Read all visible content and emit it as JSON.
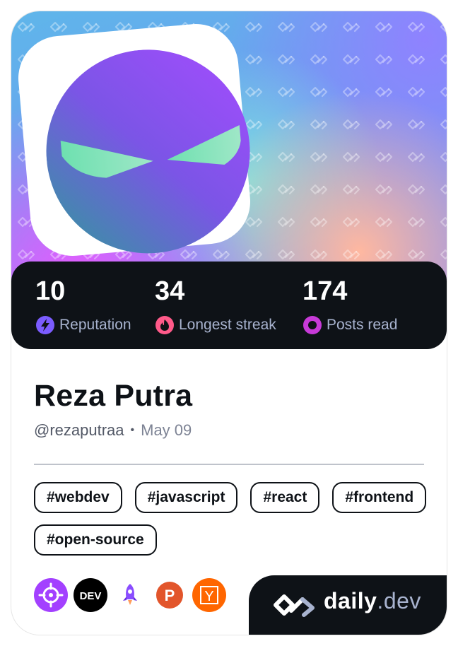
{
  "profile": {
    "name": "Reza Putra",
    "handle": "@rezaputraa",
    "separator": "•",
    "date": "May 09"
  },
  "stats": [
    {
      "value": "10",
      "label": "Reputation",
      "icon": "lightning-icon",
      "color": "#7b5cff"
    },
    {
      "value": "34",
      "label": "Longest streak",
      "icon": "flame-icon",
      "color": "#ff5a8a"
    },
    {
      "value": "174",
      "label": "Posts read",
      "icon": "eye-icon",
      "color": "#c73ad8"
    }
  ],
  "tags": [
    "#webdev",
    "#javascript",
    "#react",
    "#frontend",
    "#open-source"
  ],
  "sources": [
    {
      "icon": "crosshair-source-icon",
      "color": "#a340ff"
    },
    {
      "icon": "dev-to-source-icon",
      "label": "DEV",
      "color": "#000000"
    },
    {
      "icon": "rocket-source-icon",
      "color": "#8a4dff"
    },
    {
      "icon": "product-hunt-source-icon",
      "label": "P",
      "color": "#e2552b"
    },
    {
      "icon": "hacker-news-source-icon",
      "label": "Y",
      "color": "#ff6600"
    }
  ],
  "brand": {
    "name": "daily",
    "suffix": ".dev"
  },
  "colors": {
    "dark": "#0e1217",
    "muted": "#a8b3cf"
  }
}
